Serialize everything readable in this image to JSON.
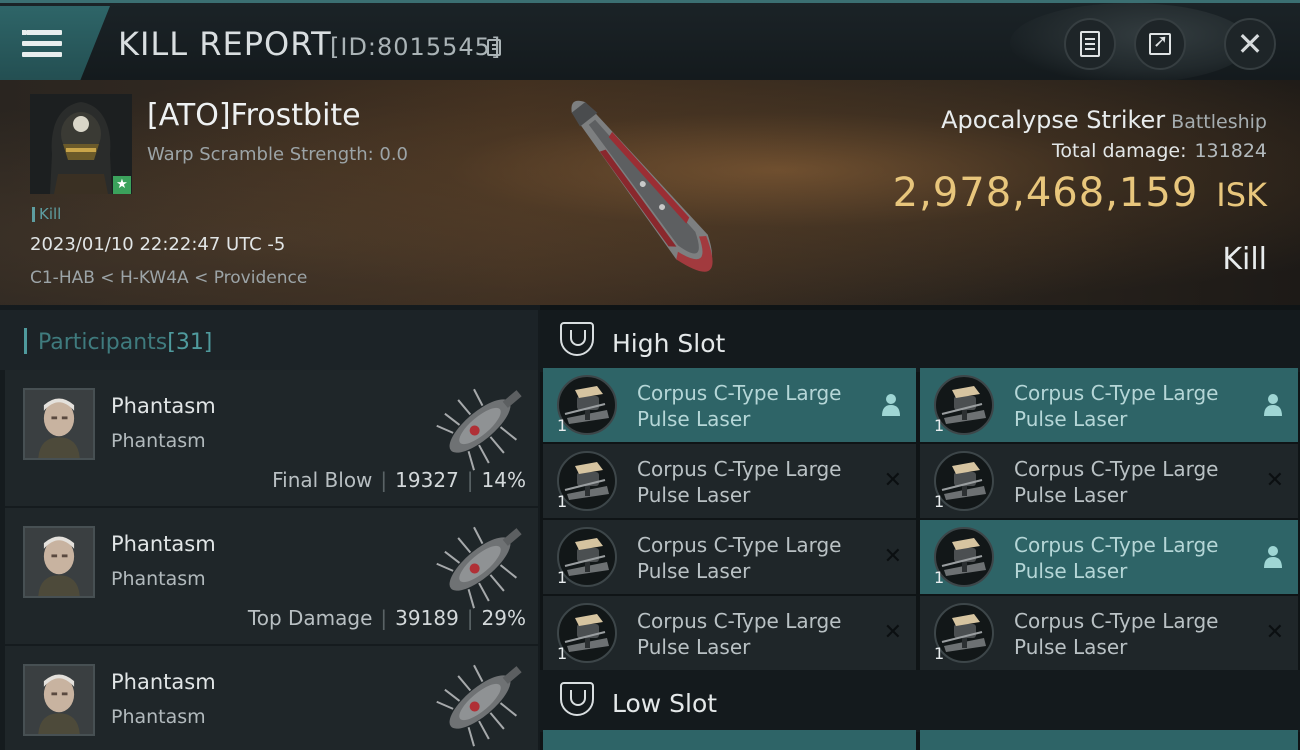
{
  "header": {
    "title": "KILL REPORT",
    "report_id": "[ID:8015545]",
    "icons": {
      "menu": "menu-icon",
      "copy": "copy-icon",
      "report": "document-icon",
      "share": "share-icon",
      "close": "close-icon"
    }
  },
  "victim": {
    "name": "[ATO]Frostbite",
    "warp_scramble": "Warp Scramble Strength: 0.0",
    "badge": "★",
    "kill_tag": "Kill",
    "datetime": "2023/01/10 22:22:47 UTC -5",
    "location": "C1-HAB < H-KW4A < Providence"
  },
  "ship": {
    "name": "Apocalypse Striker",
    "class": "Battleship",
    "total_damage_label": "Total damage:",
    "total_damage": "131824",
    "isk_value": "2,978,468,159",
    "isk_unit": "ISK",
    "outcome": "Kill"
  },
  "participants": {
    "title": "Participants",
    "count": "[31]",
    "rows": [
      {
        "name": "Phantasm",
        "ship": "Phantasm",
        "label": "Final Blow",
        "damage": "19327",
        "pct": "14%"
      },
      {
        "name": "Phantasm",
        "ship": "Phantasm",
        "label": "Top Damage",
        "damage": "39189",
        "pct": "29%"
      },
      {
        "name": "Phantasm",
        "ship": "Phantasm",
        "label": "",
        "damage": "",
        "pct": ""
      }
    ]
  },
  "slots": {
    "high_label": "High Slot",
    "low_label": "Low Slot",
    "high_modules": [
      {
        "name": "Corpus C-Type Large Pulse Laser",
        "qty": "1",
        "state": "person",
        "highlight": true
      },
      {
        "name": "Corpus C-Type Large Pulse Laser",
        "qty": "1",
        "state": "person",
        "highlight": true
      },
      {
        "name": "Corpus C-Type Large Pulse Laser",
        "qty": "1",
        "state": "destroyed",
        "highlight": false
      },
      {
        "name": "Corpus C-Type Large Pulse Laser",
        "qty": "1",
        "state": "destroyed",
        "highlight": false
      },
      {
        "name": "Corpus C-Type Large Pulse Laser",
        "qty": "1",
        "state": "destroyed",
        "highlight": false
      },
      {
        "name": "Corpus C-Type Large Pulse Laser",
        "qty": "1",
        "state": "person",
        "highlight": true
      },
      {
        "name": "Corpus C-Type Large Pulse Laser",
        "qty": "1",
        "state": "destroyed",
        "highlight": false
      },
      {
        "name": "Corpus C-Type Large Pulse Laser",
        "qty": "1",
        "state": "destroyed",
        "highlight": false
      }
    ]
  },
  "colors": {
    "accent": "#2e6467",
    "isk": "#e8c67c",
    "badge": "#3ba25c"
  }
}
